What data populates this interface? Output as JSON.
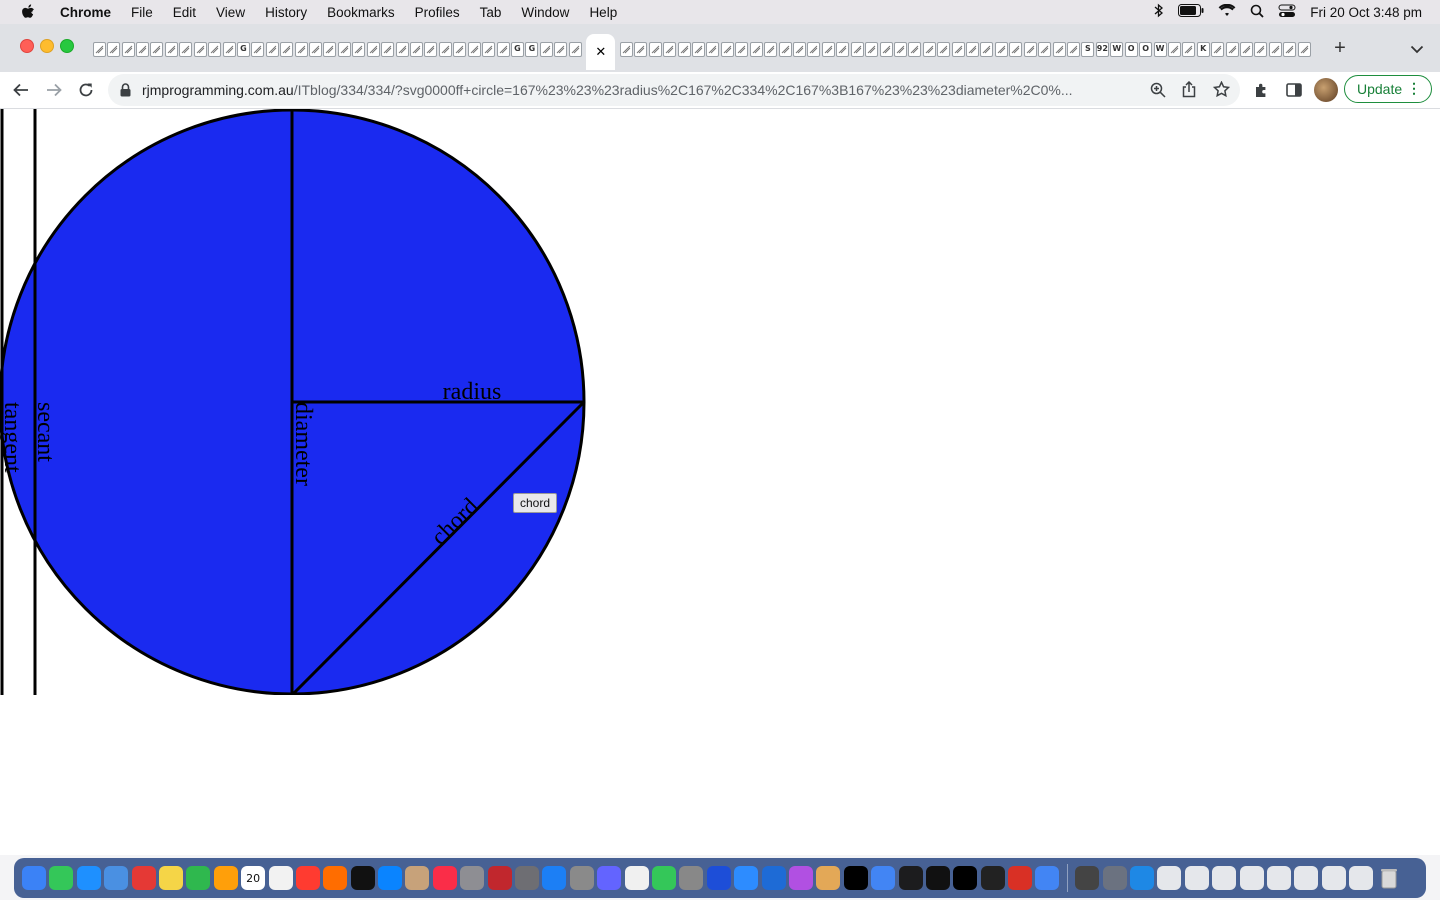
{
  "menubar": {
    "app": "Chrome",
    "items": [
      "File",
      "Edit",
      "View",
      "History",
      "Bookmarks",
      "Profiles",
      "Tab",
      "Window",
      "Help"
    ],
    "clock": "Fri 20 Oct  3:48 pm"
  },
  "browser": {
    "url_domain": "rjmprogramming.com.au",
    "url_path": "/ITblog/334/334/?svg0000ff+circle=167%23%23%23radius%2C167%2C334%2C167%3B167%23%23%23diameter%2C0%...",
    "update_label": "Update",
    "update_dots": "⋮",
    "new_tab_glyph": "+",
    "close_glyph": "✕"
  },
  "colors": {
    "circle_fill": "#1a2af0",
    "stroke": "#000000"
  },
  "diagram": {
    "labels": {
      "radius": "radius",
      "diameter": "diameter",
      "chord": "chord",
      "secant": "secant",
      "tangent": "tangent"
    },
    "tooltip": "chord"
  },
  "tabs": {
    "favicon_letters": [
      "",
      "",
      "",
      "",
      "",
      "",
      "",
      "",
      "",
      "",
      "G",
      "",
      "",
      "",
      "",
      "",
      "",
      "",
      "",
      "",
      "",
      "",
      "",
      "",
      "",
      "",
      "",
      "",
      "",
      "G",
      "G",
      "",
      "",
      "",
      "",
      "",
      "",
      "",
      "",
      "",
      "",
      "",
      "",
      "",
      "",
      "",
      "",
      "",
      "",
      "",
      "",
      "",
      "",
      "",
      "",
      "",
      "",
      "",
      "",
      "",
      "",
      "",
      "",
      "",
      "",
      "",
      "S",
      "92",
      "W",
      "O",
      "O",
      "W",
      "",
      "",
      "K",
      "",
      "",
      "",
      "",
      "",
      "",
      ""
    ]
  },
  "dock": {
    "icons": [
      "finder-icon",
      "messages-icon",
      "safari-icon",
      "mail-icon",
      "opera-icon",
      "notes-icon",
      "facetime-icon",
      "photos-icon",
      "calendar-icon",
      "reminders-icon",
      "news-icon",
      "firefox-icon",
      "tv-icon",
      "appstore-icon",
      "preferences-icon",
      "music-icon",
      "launchpad-icon",
      "filezilla-icon",
      "calculator-icon",
      "xcode-icon",
      "settings-icon",
      "mastodon-icon",
      "textedit-icon",
      "maps-icon",
      "tools-icon",
      "bbedit-icon",
      "zoom-icon",
      "keynote-icon",
      "podcasts-icon",
      "books-icon",
      "intellij-icon",
      "chrome-icon",
      "quicktime-icon",
      "inkscape-icon",
      "terminal-icon",
      "terminal-dark-icon",
      "affinity-icon",
      "chrome-alt-icon",
      "script-icon",
      "finder-folder-icon",
      "network-icon",
      "doc-icon",
      "doc-icon",
      "doc-icon",
      "doc-icon",
      "doc-icon",
      "doc-icon",
      "doc-icon",
      "doc-icon",
      "trash-icon"
    ],
    "calendar_day": "20"
  }
}
